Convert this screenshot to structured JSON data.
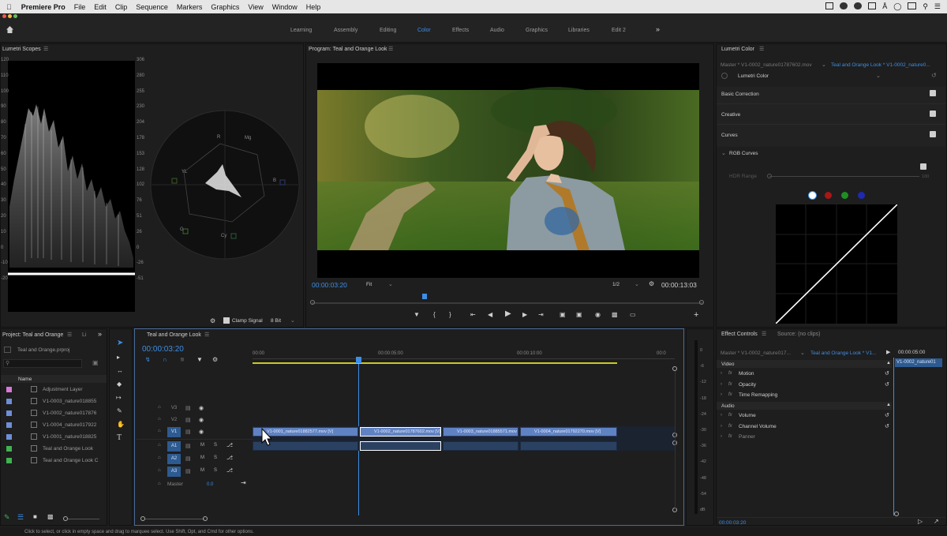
{
  "menubar": {
    "app": "Premiere Pro",
    "items": [
      "File",
      "Edit",
      "Clip",
      "Sequence",
      "Markers",
      "Graphics",
      "View",
      "Window",
      "Help"
    ]
  },
  "workspaces": [
    {
      "label": "Learning",
      "active": false
    },
    {
      "label": "Assembly",
      "active": false
    },
    {
      "label": "Editing",
      "active": false
    },
    {
      "label": "Color",
      "active": true
    },
    {
      "label": "Effects",
      "active": false
    },
    {
      "label": "Audio",
      "active": false
    },
    {
      "label": "Graphics",
      "active": false
    },
    {
      "label": "Libraries",
      "active": false
    },
    {
      "label": "Edit 2",
      "active": false
    }
  ],
  "workspaces_more": "»",
  "scopes": {
    "title": "Lumetri Scopes",
    "left_ticks": [
      "120",
      "110",
      "100",
      "90",
      "80",
      "70",
      "60",
      "50",
      "40",
      "30",
      "20",
      "10",
      "0",
      "-10",
      "-20"
    ],
    "right_ticks": [
      "306",
      "280",
      "255",
      "230",
      "204",
      "178",
      "153",
      "128",
      "102",
      "76",
      "51",
      "26",
      "0",
      "-26",
      "-51"
    ],
    "clamp_label": "Clamp Signal",
    "bit_depth": "8 Bit",
    "vector_labels": [
      "R",
      "Mg",
      "B",
      "Cy",
      "G",
      "YL"
    ]
  },
  "program": {
    "title": "Program: Teal and Orange Look",
    "timecode": "00:00:03:20",
    "fit": "Fit",
    "resolution": "1/2",
    "duration": "00:00:13:03"
  },
  "lumetri": {
    "title": "Lumetri Color",
    "master": "Master * V1-0002_nature01787602.mov",
    "sequence": "Teal and Orange Look * V1-0002_nature0...",
    "effect": "Lumetri Color",
    "sections": [
      "Basic Correction",
      "Creative",
      "Curves"
    ],
    "rgb_curves": "RGB Curves",
    "hdr_range": "HDR Range",
    "hdr_value": "100"
  },
  "project": {
    "title": "Project: Teal and Orange",
    "tab2": "Li",
    "file": "Teal and Orange.prproj",
    "col_name": "Name",
    "items": [
      {
        "name": "Adjustment Layer",
        "color": "#d877d6"
      },
      {
        "name": "V1-0003_nature018855",
        "color": "#6d8fd6"
      },
      {
        "name": "V1-0002_nature017876",
        "color": "#6d8fd6"
      },
      {
        "name": "V1-0004_nature017922",
        "color": "#6d8fd6"
      },
      {
        "name": "V1-0001_nature018825",
        "color": "#6d8fd6"
      },
      {
        "name": "Teal and Orange Look",
        "color": "#3fb34f"
      },
      {
        "name": "Teal and Orange Look C",
        "color": "#3fb34f"
      }
    ]
  },
  "timeline": {
    "title": "Teal and Orange Look",
    "timecode": "00:00:03:20",
    "ruler": [
      "00:00",
      "00:00:05:00",
      "00:00:10:00",
      "00:0"
    ],
    "tracks": [
      "V3",
      "V2",
      "V1",
      "A1",
      "A2",
      "A3"
    ],
    "master": "Master",
    "master_val": "0.0",
    "clips": [
      "V1-0001_nature01882577.mov [V]",
      "V1-0002_nature01787602.mov [V]",
      "V1-0003_nature01885571.mov",
      "V1-0004_nature01792270.mov [V]"
    ]
  },
  "meter": {
    "ticks": [
      "0",
      "-6",
      "-12",
      "-18",
      "-24",
      "-30",
      "-36",
      "-42",
      "-48",
      "-54",
      "dB"
    ]
  },
  "effect_controls": {
    "title": "Effect Controls",
    "source_tab": "Source: (no clips)",
    "master": "Master * V1-0002_nature017...",
    "sequence": "Teal and Orange Look * V1...",
    "timecode_right": "00:00:05:00",
    "clip_label": "V1-0002_nature01",
    "video_header": "Video",
    "audio_header": "Audio",
    "video_items": [
      "Motion",
      "Opacity",
      "Time Remapping"
    ],
    "audio_items": [
      "Volume",
      "Channel Volume",
      "Panner"
    ],
    "timecode": "00:00:03:20"
  },
  "status": "Click to select, or click in empty space and drag to marquee select. Use Shift, Opt, and Cmd for other options."
}
